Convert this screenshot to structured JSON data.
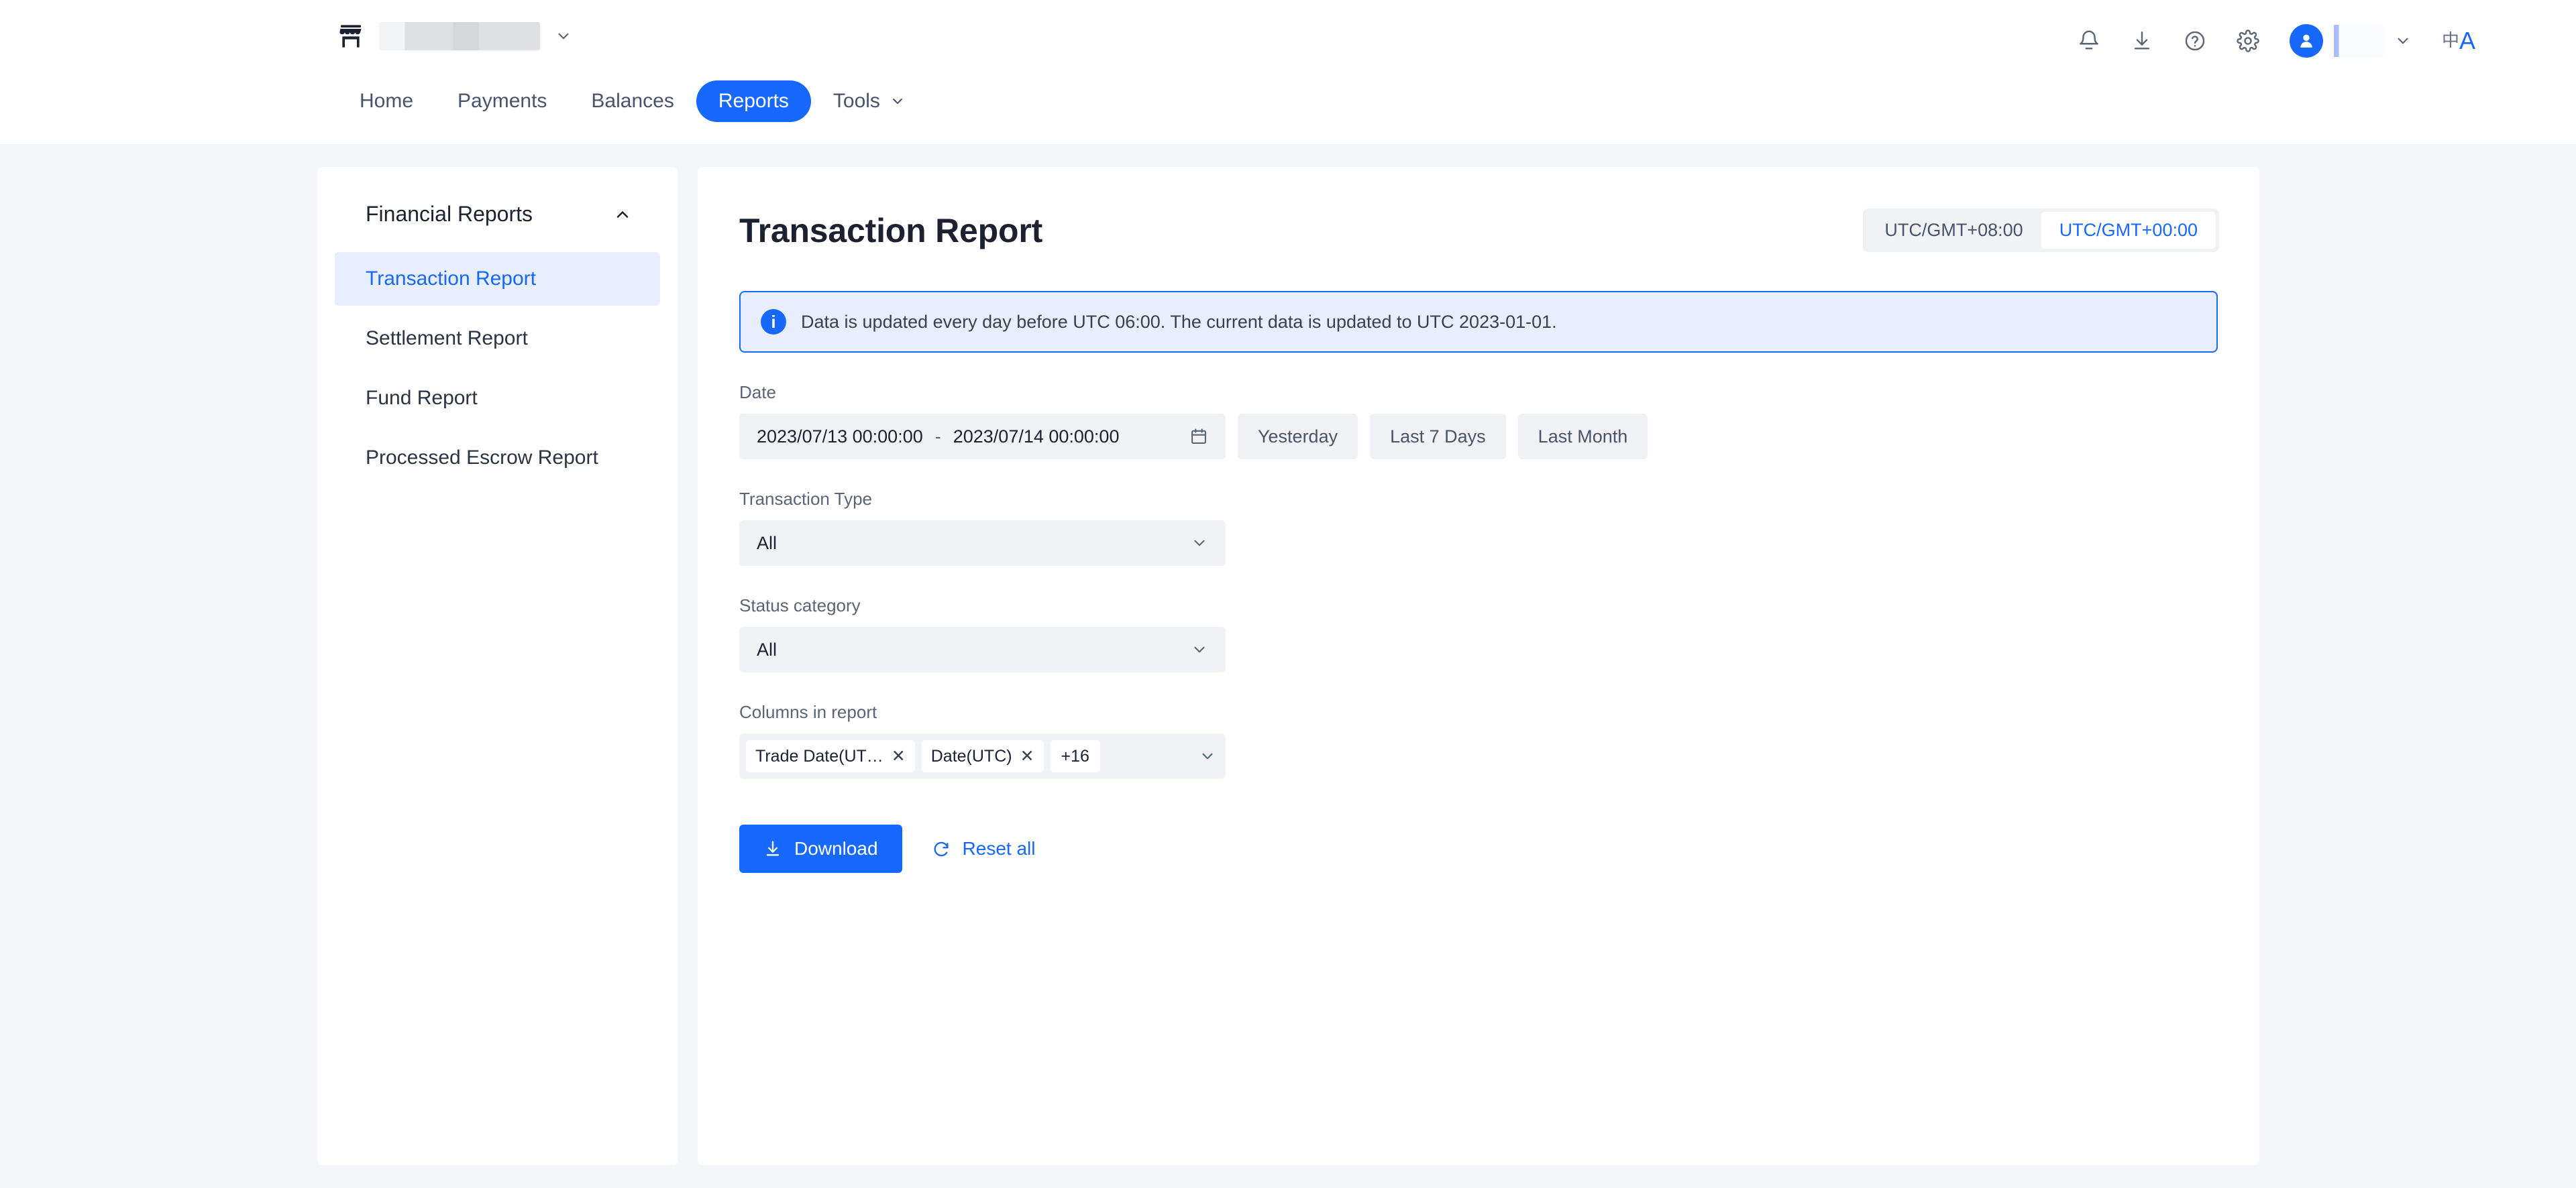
{
  "header": {
    "store_selector": {
      "icon": "store-icon",
      "name_redacted": true,
      "chevron": "chevron-down-icon"
    },
    "actions": [
      {
        "name": "notifications-icon",
        "label": "Notifications"
      },
      {
        "name": "downloads-icon",
        "label": "Downloads"
      },
      {
        "name": "help-icon",
        "label": "Help"
      },
      {
        "name": "settings-gear-icon",
        "label": "Settings"
      }
    ],
    "account": {
      "avatar": "user-avatar-icon",
      "name_redacted": true,
      "chevron": "chevron-down-icon"
    },
    "language": {
      "cn": "中",
      "en": "A"
    }
  },
  "nav": {
    "items": [
      {
        "label": "Home",
        "active": false,
        "caret": false
      },
      {
        "label": "Payments",
        "active": false,
        "caret": false
      },
      {
        "label": "Balances",
        "active": false,
        "caret": false
      },
      {
        "label": "Reports",
        "active": true,
        "caret": false
      },
      {
        "label": "Tools",
        "active": false,
        "caret": true
      }
    ]
  },
  "sidebar": {
    "title": "Financial Reports",
    "collapse_icon": "chevron-up-icon",
    "items": [
      {
        "label": "Transaction Report",
        "active": true
      },
      {
        "label": "Settlement Report",
        "active": false
      },
      {
        "label": "Fund Report",
        "active": false
      },
      {
        "label": "Processed Escrow Report",
        "active": false
      }
    ]
  },
  "main": {
    "title": "Transaction Report",
    "timezone": {
      "options": [
        {
          "label": "UTC/GMT+08:00",
          "active": false
        },
        {
          "label": "UTC/GMT+00:00",
          "active": true
        }
      ]
    },
    "banner": {
      "icon": "info-icon",
      "text": "Data is updated every day before UTC 06:00. The current data is updated to UTC 2023-01-01."
    },
    "filters": {
      "date": {
        "label": "Date",
        "start": "2023/07/13 00:00:00",
        "separator": "-",
        "end": "2023/07/14 00:00:00",
        "calendar_icon": "calendar-icon",
        "quick_ranges": [
          "Yesterday",
          "Last 7 Days",
          "Last Month"
        ]
      },
      "transaction_type": {
        "label": "Transaction Type",
        "value": "All",
        "caret": "chevron-down-icon"
      },
      "status_category": {
        "label": "Status category",
        "value": "All",
        "caret": "chevron-down-icon"
      },
      "columns": {
        "label": "Columns in report",
        "tags": [
          {
            "label": "Trade Date(UT…",
            "removable": true
          },
          {
            "label": "Date(UTC)",
            "removable": true
          }
        ],
        "overflow": "+16",
        "caret": "chevron-down-icon"
      }
    },
    "actions": {
      "download": {
        "label": "Download",
        "icon": "download-icon"
      },
      "reset": {
        "label": "Reset all",
        "icon": "refresh-icon"
      }
    }
  },
  "colors": {
    "accent": "#1668ff",
    "page_bg": "#f4f6fa",
    "field_bg": "#f0f2f5",
    "banner_bg": "#e8eefe"
  }
}
